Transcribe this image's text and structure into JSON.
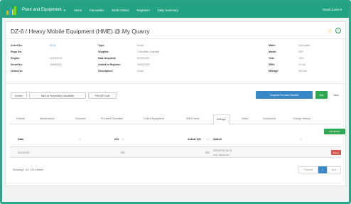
{
  "navbar": {
    "brand": "Plant and Equipment",
    "items": [
      "Home",
      "Favourites",
      "Work Orders",
      "Registers",
      "Daily Summary"
    ],
    "user": "David Jones"
  },
  "page": {
    "title": "DZ-6 / Heavy Mobile Equipment (HME) @ My Quarry"
  },
  "details": {
    "left": [
      {
        "label": "Asset No:",
        "value": "DZ-6"
      },
      {
        "label": "Rego No:",
        "value": ""
      },
      {
        "label": "Engine:",
        "value": "LHKX5576"
      },
      {
        "label": "Serial No:",
        "value": "JKBB0362"
      },
      {
        "label": "Linked to:",
        "value": ""
      }
    ],
    "middle": [
      {
        "label": "Type:",
        "value": "Dozer"
      },
      {
        "label": "Supplier:",
        "value": "Caterpillar Australia"
      },
      {
        "label": "Date Acquired:",
        "value": "02/09/1997"
      },
      {
        "label": "Added to Register:",
        "value": "04/06/2020"
      },
      {
        "label": "Description:",
        "value": "Dozer"
      }
    ],
    "right": [
      {
        "label": "Make:",
        "value": "Caterpillar"
      },
      {
        "label": "Model:",
        "value": "D8T"
      },
      {
        "label": "Year:",
        "value": "1997"
      },
      {
        "label": "SMU:",
        "value": "10 hrs"
      },
      {
        "label": "Mileage:",
        "value": "500 km"
      }
    ]
  },
  "actions": {
    "archive": "Archive",
    "unavailable": "Mark as Temporarily Unavailable",
    "qr": "Print QR Code",
    "checklist": "Complete Pre-start Checklist",
    "edit": "Edit",
    "back": "Back"
  },
  "tabs": [
    "Defects",
    "Maintenance",
    "Schedule",
    "Pre-start Checklists",
    "Linked Equipment",
    "SMU Hours",
    "Mileage",
    "Notes",
    "Documents",
    "Change History"
  ],
  "active_tab": "Mileage",
  "add_mileage": "Add Mileage",
  "table": {
    "headers": [
      "Date",
      "KM",
      "Actual KM",
      "Added"
    ],
    "rows": [
      {
        "date": "22/11/2021",
        "km": "500",
        "actual": "500",
        "added": "22/11/2021 16:19",
        "added_by": "Peter Macdonald",
        "action": "Delete"
      }
    ]
  },
  "footer": {
    "showing": "Showing 1 to 1 of 1 entries",
    "previous": "Previous",
    "page": "1",
    "next": "Next"
  },
  "colors": {
    "navbar": "#23a383",
    "primary": "#3a87c8",
    "success": "#2fa84f",
    "danger": "#d9534f",
    "star": "#e0a800"
  }
}
